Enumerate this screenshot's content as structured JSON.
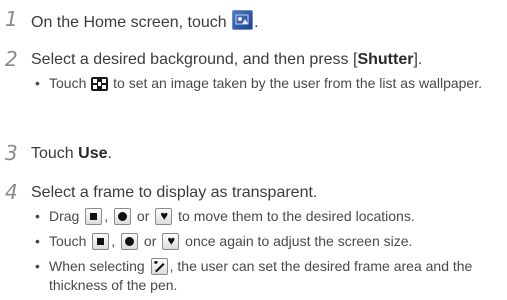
{
  "steps": [
    {
      "number": "1",
      "text_before": "On the Home screen, touch",
      "text_after": "."
    },
    {
      "number": "2",
      "text_before": "Select a desired background, and then press [",
      "bold": "Shutter",
      "text_after": "]."
    },
    {
      "number": "3",
      "text_before": "Touch",
      "bold": "Use",
      "text_after": "."
    },
    {
      "number": "4",
      "text_before": "Select a frame to display as transparent."
    }
  ],
  "bullets": {
    "b2_1": {
      "before": "Touch",
      "after": "to set an image taken by the user from the list as wallpaper."
    },
    "b4_1": {
      "before": "Drag",
      "sep1": ",",
      "sep2": "or",
      "after": "to move them to the desired locations."
    },
    "b4_2": {
      "before": "Touch",
      "sep1": ",",
      "sep2": "or",
      "after": "once again to adjust the screen size."
    },
    "b4_3": {
      "before": "When selecting",
      "after": ", the user can set the desired frame area and the thickness of the pen."
    }
  },
  "bullet_symbol": "•",
  "icons": {
    "home_app": "transparent-wallpaper-app-icon",
    "gallery": "gallery-grid-icon",
    "square": "square-frame-icon",
    "circle": "circle-frame-icon",
    "heart": "heart-frame-icon",
    "pen": "pen-frame-icon"
  }
}
